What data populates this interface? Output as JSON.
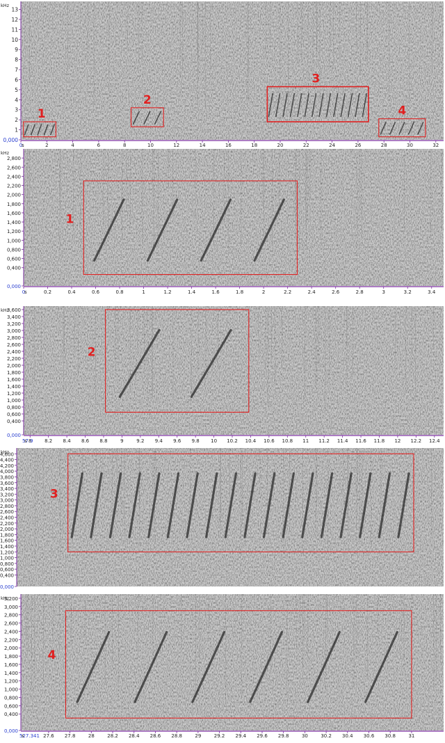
{
  "chart_data": [
    {
      "type": "heatmap",
      "xlabel": "s",
      "ylabel": "kHz",
      "xlim": [
        0,
        32.6
      ],
      "ylim": [
        0,
        13.8
      ],
      "x_tick_labels": [
        "0",
        "2",
        "4",
        "6",
        "8",
        "10",
        "12",
        "14",
        "16",
        "18",
        "20",
        "22",
        "24",
        "26",
        "28",
        "30",
        "32"
      ],
      "x_tick_values": [
        0,
        2,
        4,
        6,
        8,
        10,
        12,
        14,
        16,
        18,
        20,
        22,
        24,
        26,
        28,
        30,
        32
      ],
      "y_tick_labels": [
        "0,000",
        "1",
        "2",
        "3",
        "4",
        "5",
        "6",
        "7",
        "8",
        "9",
        "10",
        "11",
        "12",
        "13"
      ],
      "y_tick_values": [
        0,
        1,
        2,
        3,
        4,
        5,
        6,
        7,
        8,
        9,
        10,
        11,
        12,
        13
      ],
      "annotations": [
        {
          "label": "1",
          "x0": 0.2,
          "x1": 2.7,
          "y0": 0.3,
          "y1": 1.8
        },
        {
          "label": "2",
          "x0": 8.5,
          "x1": 11.0,
          "y0": 1.3,
          "y1": 3.2
        },
        {
          "label": "3",
          "x0": 19.0,
          "x1": 26.8,
          "y0": 1.8,
          "y1": 5.3
        },
        {
          "label": "4",
          "x0": 27.6,
          "x1": 31.2,
          "y0": 0.3,
          "y1": 2.1
        }
      ]
    },
    {
      "type": "heatmap",
      "xlabel": "s",
      "ylabel": "kHz",
      "xlim": [
        0,
        3.5
      ],
      "ylim": [
        0,
        3000
      ],
      "x_tick_labels": [
        "0",
        "0.2",
        "0.4",
        "0.6",
        "0.8",
        "1",
        "1.2",
        "1.4",
        "1.6",
        "1.8",
        "2",
        "2.2",
        "2.4",
        "2.6",
        "2.8",
        "3",
        "3.2",
        "3.4"
      ],
      "x_tick_values": [
        0,
        0.2,
        0.4,
        0.6,
        0.8,
        1,
        1.2,
        1.4,
        1.6,
        1.8,
        2,
        2.2,
        2.4,
        2.6,
        2.8,
        3,
        3.2,
        3.4
      ],
      "y_tick_labels": [
        "0,000",
        "0,400",
        "0,600",
        "0,800",
        "1,000",
        "1,200",
        "1,400",
        "1,600",
        "1,800",
        "2,000",
        "2,200",
        "2,400",
        "2,600",
        "2,800"
      ],
      "y_tick_values": [
        0,
        400,
        600,
        800,
        1000,
        1200,
        1400,
        1600,
        1800,
        2000,
        2200,
        2400,
        2600,
        2800
      ],
      "annotations": [
        {
          "label": "1",
          "x0": 0.5,
          "x1": 2.28,
          "y0": 250,
          "y1": 2300
        }
      ]
    },
    {
      "type": "heatmap",
      "xlabel": "s",
      "ylabel": "kHz",
      "x_start_label": "57.9",
      "xlim": [
        7.93,
        12.5
      ],
      "ylim": [
        0,
        3700
      ],
      "x_tick_labels": [
        "8",
        "8.2",
        "8.4",
        "8.6",
        "8.8",
        "9",
        "9.2",
        "9.4",
        "9.6",
        "9.8",
        "10",
        "10.2",
        "10.4",
        "10.6",
        "10.8",
        "11",
        "11.2",
        "11.4",
        "11.6",
        "11.8",
        "12",
        "12.2",
        "12.4"
      ],
      "x_tick_values": [
        8,
        8.2,
        8.4,
        8.6,
        8.8,
        9,
        9.2,
        9.4,
        9.6,
        9.8,
        10,
        10.2,
        10.4,
        10.6,
        10.8,
        11,
        11.2,
        11.4,
        11.6,
        11.8,
        12,
        12.2,
        12.4
      ],
      "y_tick_labels": [
        "0,000",
        "0,400",
        "0,600",
        "0,800",
        "1,000",
        "1,200",
        "1,400",
        "1,600",
        "1,800",
        "2,000",
        "2,200",
        "2,400",
        "2,600",
        "2,800",
        "3,000",
        "3,200",
        "3,400",
        "3,600"
      ],
      "y_tick_values": [
        0,
        400,
        600,
        800,
        1000,
        1200,
        1400,
        1600,
        1800,
        2000,
        2200,
        2400,
        2600,
        2800,
        3000,
        3200,
        3400,
        3600
      ],
      "annotations": [
        {
          "label": "2",
          "x0": 8.82,
          "x1": 10.38,
          "y0": 650,
          "y1": 3600
        }
      ]
    },
    {
      "type": "heatmap",
      "ylabel": "kHz",
      "ylim": [
        0,
        4800
      ],
      "y_tick_labels": [
        "0,000",
        "0,400",
        "0,600",
        "0,800",
        "1,000",
        "1,200",
        "1,400",
        "1,600",
        "1,800",
        "2,000",
        "2,200",
        "2,400",
        "2,600",
        "2,800",
        "3,000",
        "3,200",
        "3,400",
        "3,600",
        "3,800",
        "4,000",
        "4,200",
        "4,400",
        "4,600"
      ],
      "y_tick_values": [
        0,
        400,
        600,
        800,
        1000,
        1200,
        1400,
        1600,
        1800,
        2000,
        2200,
        2400,
        2600,
        2800,
        3000,
        3200,
        3400,
        3600,
        3800,
        4000,
        4200,
        4400,
        4600
      ],
      "annotations": [
        {
          "label": "3",
          "x0": 0.12,
          "x1": 0.93,
          "y0": 1200,
          "y1": 4600
        }
      ]
    },
    {
      "type": "heatmap",
      "xlabel": "s",
      "ylabel": "kHz",
      "x_start_label": "527.341",
      "xlim": [
        27.34,
        31.3
      ],
      "ylim": [
        0,
        3300
      ],
      "x_tick_labels": [
        "27.6",
        "27.8",
        "28",
        "28.2",
        "28.4",
        "28.6",
        "28.8",
        "29",
        "29.2",
        "29.4",
        "29.6",
        "29.8",
        "30",
        "30.2",
        "30.4",
        "30.6",
        "30.8",
        "31"
      ],
      "x_tick_values": [
        27.6,
        27.8,
        28,
        28.2,
        28.4,
        28.6,
        28.8,
        29,
        29.2,
        29.4,
        29.6,
        29.8,
        30,
        30.2,
        30.4,
        30.6,
        30.8,
        31
      ],
      "y_tick_labels": [
        "0,000",
        "0,400",
        "0,600",
        "0,800",
        "1,000",
        "1,200",
        "1,400",
        "1,600",
        "1,800",
        "2,000",
        "2,200",
        "2,400",
        "2,600",
        "2,800",
        "3,000",
        "3,200"
      ],
      "y_tick_values": [
        0,
        400,
        600,
        800,
        1000,
        1200,
        1400,
        1600,
        1800,
        2000,
        2200,
        2400,
        2600,
        2800,
        3000,
        3200
      ],
      "annotations": [
        {
          "label": "4",
          "x0": 27.76,
          "x1": 31.0,
          "y0": 300,
          "y1": 2900
        }
      ]
    }
  ],
  "colors": {
    "annotation": "#e02020",
    "axis_line": "#7a2f9f",
    "tick_text": "#222222",
    "origin_text": "#2a3fd0"
  }
}
